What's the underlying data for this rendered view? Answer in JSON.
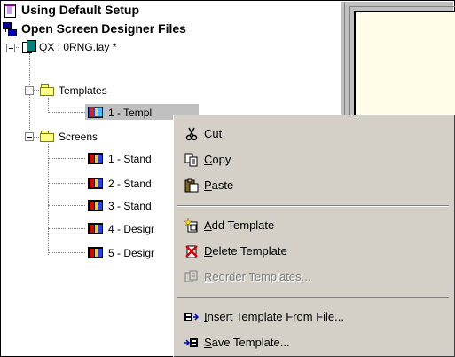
{
  "tree": {
    "root1": "Using Default Setup",
    "root2": "Open Screen Designer Files",
    "layout_file": "QX : 0RNG.lay *",
    "templates_folder": "Templates",
    "template_item": "1 - Templ",
    "screens_folder": "Screens",
    "screens": [
      "1 - Stand",
      "2 - Stand",
      "3 - Stand",
      "4 - Desigr",
      "5 - Desigr"
    ]
  },
  "context_menu": {
    "items": [
      {
        "pre": "",
        "key": "C",
        "post": "ut",
        "icon": "scissors-icon",
        "enabled": true
      },
      {
        "pre": "",
        "key": "C",
        "post": "opy",
        "icon": "copy-icon",
        "enabled": true
      },
      {
        "pre": "",
        "key": "P",
        "post": "aste",
        "icon": "paste-icon",
        "enabled": true
      },
      {
        "pre": "",
        "key": "A",
        "post": "dd Template",
        "icon": "add-template-icon",
        "enabled": true
      },
      {
        "pre": "",
        "key": "D",
        "post": "elete Template",
        "icon": "delete-template-icon",
        "enabled": true
      },
      {
        "pre": "",
        "key": "R",
        "post": "eorder Templates...",
        "icon": "reorder-templates-icon",
        "enabled": false
      },
      {
        "pre": "",
        "key": "I",
        "post": "nsert Template From File...",
        "icon": "insert-from-file-icon",
        "enabled": true
      },
      {
        "pre": "",
        "key": "S",
        "post": "ave Template...",
        "icon": "save-template-icon",
        "enabled": true
      }
    ]
  },
  "colors": {
    "menu_bg": "#d4d0c8",
    "canvas_bg": "#fffde8",
    "selection": "#c0c0c0"
  }
}
